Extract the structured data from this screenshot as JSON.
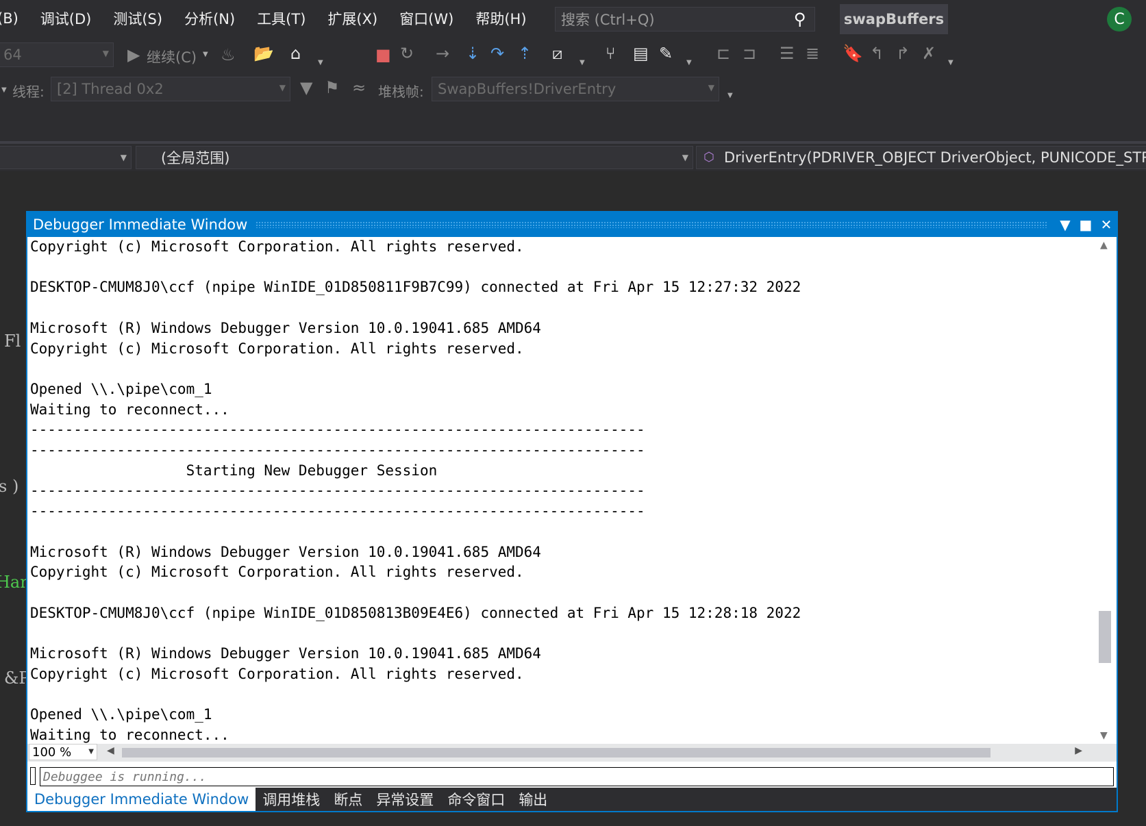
{
  "menu": {
    "items": [
      "(B)",
      "调试(D)",
      "测试(S)",
      "分析(N)",
      "工具(T)",
      "扩展(X)",
      "窗口(W)",
      "帮助(H)"
    ],
    "search_placeholder": "搜索 (Ctrl+Q)",
    "solution_name": "swapBuffers",
    "avatar_letter": "C"
  },
  "toolbar": {
    "platform_value": "64",
    "continue_label": "继续(C)",
    "thread_label": "线程:",
    "thread_value": "[2] Thread 0x2",
    "stackframe_label": "堆栈帧:",
    "stackframe_value": "SwapBuffers!DriverEntry"
  },
  "navbar": {
    "scope_value": "(全局范围)",
    "function_value": "DriverEntry(PDRIVER_OBJECT DriverObject, PUNICODE_STRIN"
  },
  "editor_fragments": [
    "Fl",
    "s )",
    "Han",
    "&P"
  ],
  "immediate_window": {
    "title": "Debugger Immediate Window",
    "output_lines": [
      "Copyright (c) Microsoft Corporation. All rights reserved.",
      "",
      "DESKTOP-CMUM8J0\\ccf (npipe WinIDE_01D850811F9B7C99) connected at Fri Apr 15 12:27:32 2022",
      "",
      "Microsoft (R) Windows Debugger Version 10.0.19041.685 AMD64",
      "Copyright (c) Microsoft Corporation. All rights reserved.",
      "",
      "Opened \\\\.\\pipe\\com_1",
      "Waiting to reconnect...",
      "-----------------------------------------------------------------------",
      "-----------------------------------------------------------------------",
      "                  Starting New Debugger Session",
      "-----------------------------------------------------------------------",
      "-----------------------------------------------------------------------",
      "",
      "Microsoft (R) Windows Debugger Version 10.0.19041.685 AMD64",
      "Copyright (c) Microsoft Corporation. All rights reserved.",
      "",
      "DESKTOP-CMUM8J0\\ccf (npipe WinIDE_01D850813B09E4E6) connected at Fri Apr 15 12:28:18 2022",
      "",
      "Microsoft (R) Windows Debugger Version 10.0.19041.685 AMD64",
      "Copyright (c) Microsoft Corporation. All rights reserved.",
      "",
      "Opened \\\\.\\pipe\\com_1",
      "Waiting to reconnect..."
    ],
    "zoom": "100 %",
    "command_placeholder": "Debuggee is running..."
  },
  "bottom_tabs": [
    "Debugger Immediate Window",
    "调用堆栈",
    "断点",
    "异常设置",
    "命令窗口",
    "输出"
  ]
}
